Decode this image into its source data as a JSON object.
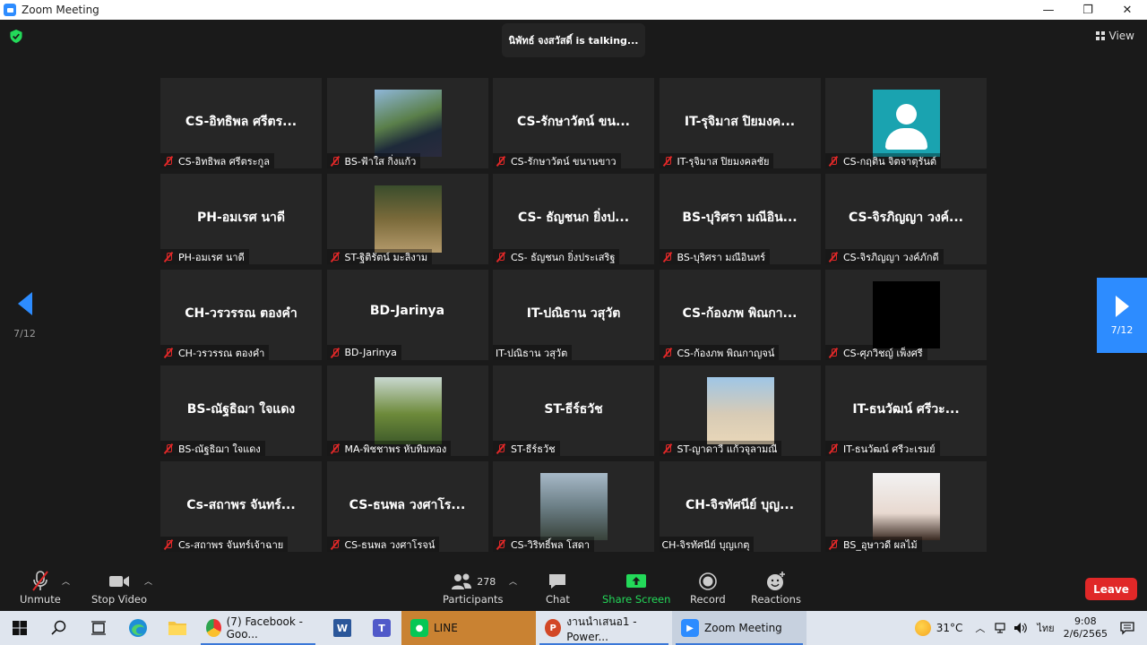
{
  "window": {
    "title": "Zoom Meeting",
    "minimize": "—",
    "maximize": "❐",
    "close": "✕"
  },
  "meeting": {
    "talking_text": "นิพัทธ์ จงสวัสดิ์ is  talking...",
    "view_label": "View",
    "page_indicator": "7/12",
    "accent_color": "#2d8cff"
  },
  "participants": [
    {
      "big": "CS-อิทธิพล ศรีตร...",
      "label": "CS-อิทธิพล ศรีตระกูล",
      "muted": true,
      "photo": ""
    },
    {
      "big": "",
      "label": "BS-ฟ้าใส กิ่งแก้ว",
      "muted": true,
      "photo": "p-grad1"
    },
    {
      "big": "CS-รักษาวัตน์ ขน...",
      "label": "CS-รักษาวัตน์ ขนานขาว",
      "muted": true,
      "photo": ""
    },
    {
      "big": "IT-รุจิมาส ปิยมงค...",
      "label": "IT-รุจิมาส ปิยมงคลชัย",
      "muted": true,
      "photo": ""
    },
    {
      "big": "",
      "label": "CS-กฤติน จิตจาตุรันต์",
      "muted": true,
      "photo": "p-avatar"
    },
    {
      "big": "PH-อมเรศ นาดี",
      "label": "PH-อมเรศ นาดี",
      "muted": true,
      "photo": ""
    },
    {
      "big": "",
      "label": "ST-ฐิติรัตน์ มะลิงาม",
      "muted": true,
      "photo": "p-grad2"
    },
    {
      "big": "CS- ธัญชนก ยิ่งป...",
      "label": "CS- ธัญชนก ยิ่งประเสริฐ",
      "muted": true,
      "photo": ""
    },
    {
      "big": "BS-บุริศรา มณีอิน...",
      "label": "BS-บุริศรา มณีอินทร์",
      "muted": true,
      "photo": ""
    },
    {
      "big": "CS-จิรภิญญา วงค์...",
      "label": "CS-จิรภิญญา วงค์ภักดี",
      "muted": true,
      "photo": ""
    },
    {
      "big": "CH-วรวรรณ ตองคำ",
      "label": "CH-วรวรรณ ตองคำ",
      "muted": true,
      "photo": ""
    },
    {
      "big": "BD-Jarinya",
      "label": "BD-Jarinya",
      "muted": true,
      "photo": ""
    },
    {
      "big": "IT-ปณิธาน วสุวัต",
      "label": "IT-ปณิธาน วสุวัต",
      "muted": false,
      "photo": ""
    },
    {
      "big": "CS-ก้องภพ พิณกา...",
      "label": "CS-ก้องภพ พิณกาญจน์",
      "muted": true,
      "photo": ""
    },
    {
      "big": "",
      "label": "CS-ศุภวิชญ์ เพ็งศรี",
      "muted": true,
      "photo": "p-black"
    },
    {
      "big": "BS-ณัฐธิฌา ใจแดง",
      "label": "BS-ณัฐธิฌา ใจแดง",
      "muted": true,
      "photo": ""
    },
    {
      "big": "",
      "label": "MA-พิชชาพร หับทิมทอง",
      "muted": true,
      "photo": "p-grad3"
    },
    {
      "big": "ST-ธีร์ธวัช",
      "label": "ST-ธีร์ธวัช",
      "muted": true,
      "photo": ""
    },
    {
      "big": "",
      "label": "ST-ญาดาวี แก้วจุลามณี",
      "muted": true,
      "photo": "p-grad4"
    },
    {
      "big": "IT-ธนวัฒน์ ศรีวะ...",
      "label": "IT-ธนวัฒน์ ศรีวะเรมย์",
      "muted": true,
      "photo": ""
    },
    {
      "big": "Cs-สถาพร จันทร์...",
      "label": "Cs-สถาพร จันทร์เจ้าฉาย",
      "muted": true,
      "photo": ""
    },
    {
      "big": "CS-ธนพล วงศาโร...",
      "label": "CS-ธนพล วงศาโรจน์",
      "muted": true,
      "photo": ""
    },
    {
      "big": "",
      "label": "CS-วิริทธิ์พล โสดา",
      "muted": true,
      "photo": "p-grad5"
    },
    {
      "big": "CH-จิรทัศนีย์  บุญ...",
      "label": "CH-จิรทัศนีย์  บุญเกตุ",
      "muted": false,
      "photo": ""
    },
    {
      "big": "",
      "label": "BS_อุษาวดี ผลไม้",
      "muted": true,
      "photo": "p-grad6"
    }
  ],
  "toolbar": {
    "unmute": "Unmute",
    "stop_video": "Stop Video",
    "participants": "Participants",
    "participants_count": "278",
    "chat": "Chat",
    "share_screen": "Share Screen",
    "record": "Record",
    "reactions": "Reactions",
    "leave": "Leave",
    "share_color": "#23d959",
    "leave_color": "#e02828"
  },
  "taskbar": {
    "apps": [
      {
        "label": "(7) Facebook - Goo...",
        "icon": "chrome"
      },
      {
        "label": "LINE",
        "icon": "line"
      },
      {
        "label": "งานนำเสนอ1 - Power...",
        "icon": "powerpoint"
      },
      {
        "label": "Zoom Meeting",
        "icon": "zoom"
      }
    ],
    "temperature": "31°C",
    "language": "ไทย",
    "time": "9:08",
    "date": "2/6/2565"
  }
}
